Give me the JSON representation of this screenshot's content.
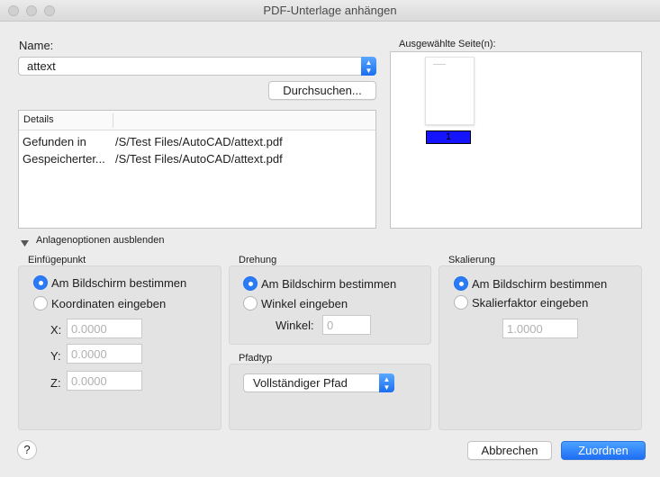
{
  "window": {
    "title": "PDF-Unterlage anhängen"
  },
  "name_section": {
    "label": "Name:",
    "value": "attext",
    "browse_label": "Durchsuchen..."
  },
  "details": {
    "header": "Details",
    "rows": [
      {
        "key": "Gefunden in",
        "value": "/S/Test Files/AutoCAD/attext.pdf"
      },
      {
        "key": "Gespeicherter...",
        "value": "/S/Test Files/AutoCAD/attext.pdf"
      }
    ]
  },
  "pages": {
    "label": "Ausgewählte Seite(n):",
    "selected_page": "1"
  },
  "toggle": {
    "label": "Anlagenoptionen ausblenden"
  },
  "insertion": {
    "title": "Einfügepunkt",
    "option_screen": "Am Bildschirm bestimmen",
    "option_coords": "Koordinaten eingeben",
    "x_label": "X:",
    "y_label": "Y:",
    "z_label": "Z:",
    "x_value": "0.0000",
    "y_value": "0.0000",
    "z_value": "0.0000"
  },
  "rotation": {
    "title": "Drehung",
    "option_screen": "Am Bildschirm bestimmen",
    "option_angle": "Winkel eingeben",
    "angle_label": "Winkel:",
    "angle_value": "0"
  },
  "scale": {
    "title": "Skalierung",
    "option_screen": "Am Bildschirm bestimmen",
    "option_factor": "Skalierfaktor eingeben",
    "factor_value": "1.0000"
  },
  "pathtype": {
    "title": "Pfadtyp",
    "value": "Vollständiger Pfad"
  },
  "footer": {
    "help": "?",
    "cancel": "Abbrechen",
    "ok": "Zuordnen"
  },
  "colors": {
    "accent": "#2a7bf5",
    "page_highlight": "#1414ff"
  }
}
